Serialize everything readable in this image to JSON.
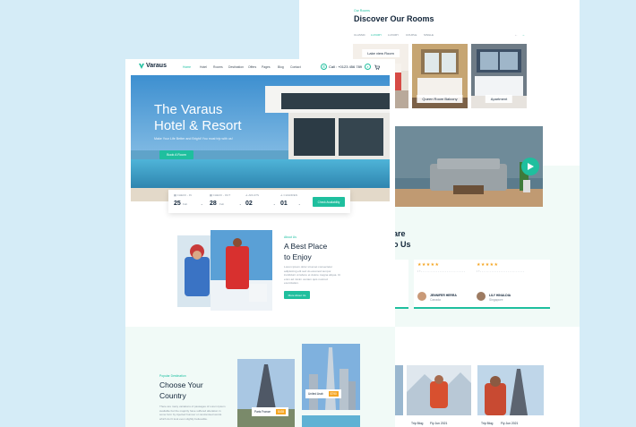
{
  "colors": {
    "accent": "#1fbf9e",
    "background": "#d5ecf7",
    "price": "#f5a623"
  },
  "back_page": {
    "rooms": {
      "eyebrow": "Our Rooms",
      "title": "Discover Our Rooms",
      "tabs": [
        "CLASSIC",
        "LUXURY",
        "LUXURY",
        "COUPLE",
        "SINGLE"
      ],
      "active_tab": 1,
      "cards": [
        "Lake view Room",
        "Queen Room Balcony",
        "Apartment"
      ]
    },
    "about_partial": {
      "line1": "are",
      "line2": "o Us"
    },
    "testimonials": [
      {
        "rating": 5,
        "name": "JENNIFER HERRA",
        "location": "Canada"
      },
      {
        "rating": 5,
        "name": "LILY HINALDIA",
        "location": "Singapore"
      }
    ],
    "gallery_captions": [
      "Trip Blog",
      "Fly Jun 2021",
      "Trip Blog",
      "Fly Jun 2021"
    ],
    "video": {
      "play_icon": "play-icon"
    }
  },
  "front_page": {
    "logo": "Varaus",
    "nav": [
      "Home",
      "Hotel",
      "Rooms",
      "Destination",
      "Offers",
      "Pages",
      "Blog",
      "Contact"
    ],
    "active_nav": 0,
    "call": "Call : +0123 456 789",
    "hero": {
      "title_line1": "The Varaus",
      "title_line2": "Hotel & Resort",
      "subtitle": "Make Your Life Better and Bright! You must trip with us!",
      "cta": "Book A Room"
    },
    "booking": {
      "checkin_label": "CHECK - IN",
      "checkin_day": "25",
      "checkin_month": "Feb",
      "checkout_label": "CHECK - OUT",
      "checkout_day": "28",
      "checkout_month": "Feb",
      "adults_label": "ADULTS",
      "adults": "02",
      "children_label": "CHILDREN",
      "children": "01",
      "cta": "Check Availability"
    },
    "about": {
      "eyebrow": "About Us",
      "title_line1": "A Best Place",
      "title_line2": "to Enjoy",
      "text": "Lorem ipsum dolor sit amet consectetur adipisicing elit sed do eiusmod tempor incididunt ut labore et dolore magna aliqua. Ut enim ad minim veniam quis nostrud exercitation.",
      "cta": "More About Us"
    },
    "destinations": {
      "eyebrow": "Popular Destination",
      "title_line1": "Choose Your",
      "title_line2": "Country",
      "text": "There are many variations of passages of Lorem Ipsum available but the majority have suffered alteration in some form by injected humour or randomised words which don't look even slightly believable.",
      "cards": [
        {
          "name": "Paris France",
          "price": "$435"
        },
        {
          "name": "United Arab",
          "price": "$790"
        }
      ]
    }
  }
}
